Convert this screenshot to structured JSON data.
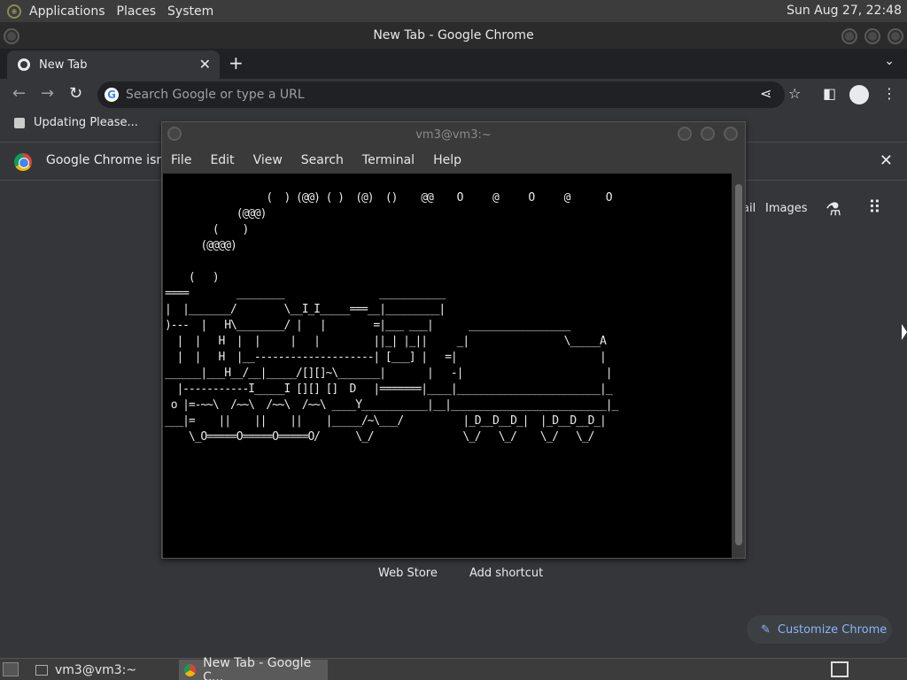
{
  "top_panel": {
    "menus": [
      "Applications",
      "Places",
      "System"
    ],
    "clock": "Sun Aug 27, 22:48"
  },
  "chrome": {
    "window_title": "New Tab - Google Chrome",
    "tab": {
      "title": "New Tab",
      "close": "✕"
    },
    "new_tab": "+",
    "tab_dropdown": "⌄",
    "omnibox_placeholder": "Search Google or type a URL",
    "bookmark": "Updating Please...",
    "infobar_text": "Google Chrome isn't y",
    "infobar_close": "✕",
    "ntp_links": {
      "gmail_partial": "ail",
      "images": "Images"
    },
    "shortcuts": [
      "Web Store",
      "Add shortcut"
    ],
    "customize": "Customize Chrome"
  },
  "terminal": {
    "title": "vm3@vm3:~",
    "menus": [
      "File",
      "Edit",
      "View",
      "Search",
      "Terminal",
      "Help"
    ],
    "output": "                 (  ) (@@) ( )  (@)  ()    @@    O     @     O     @      O\n            (@@@)\n        (    )\n      (@@@@)\n\n    (   )\n====        ________                ___________\n|  |_______/        \\__I_I_____===__|_________|\n)---  |   H\\________/ |   |        =|___ ___|      _________________\n  |  |   H  |  |     |   |         ||_| |_||     _|                \\_____A\n  |  |   H  |__--------------------| [___] |   =|                        |\n______|___H__/__|_____/[][]~\\_______|       |   -|                        |\n  |-----------I_____I [][] []  D   |=======|____|________________________|_\n o |=-~~\\  /~~\\  /~~\\  /~~\\ ____Y___________|__|__________________________|_\n___|=    ||    ||    ||    |_____/~\\___/          |_D__D__D_|  |_D__D__D_|\n    \\_O=====O=====O=====O/      \\_/               \\_/   \\_/    \\_/   \\_/"
  },
  "taskbar": {
    "tasks": [
      "vm3@vm3:~",
      "New Tab - Google C..."
    ]
  }
}
